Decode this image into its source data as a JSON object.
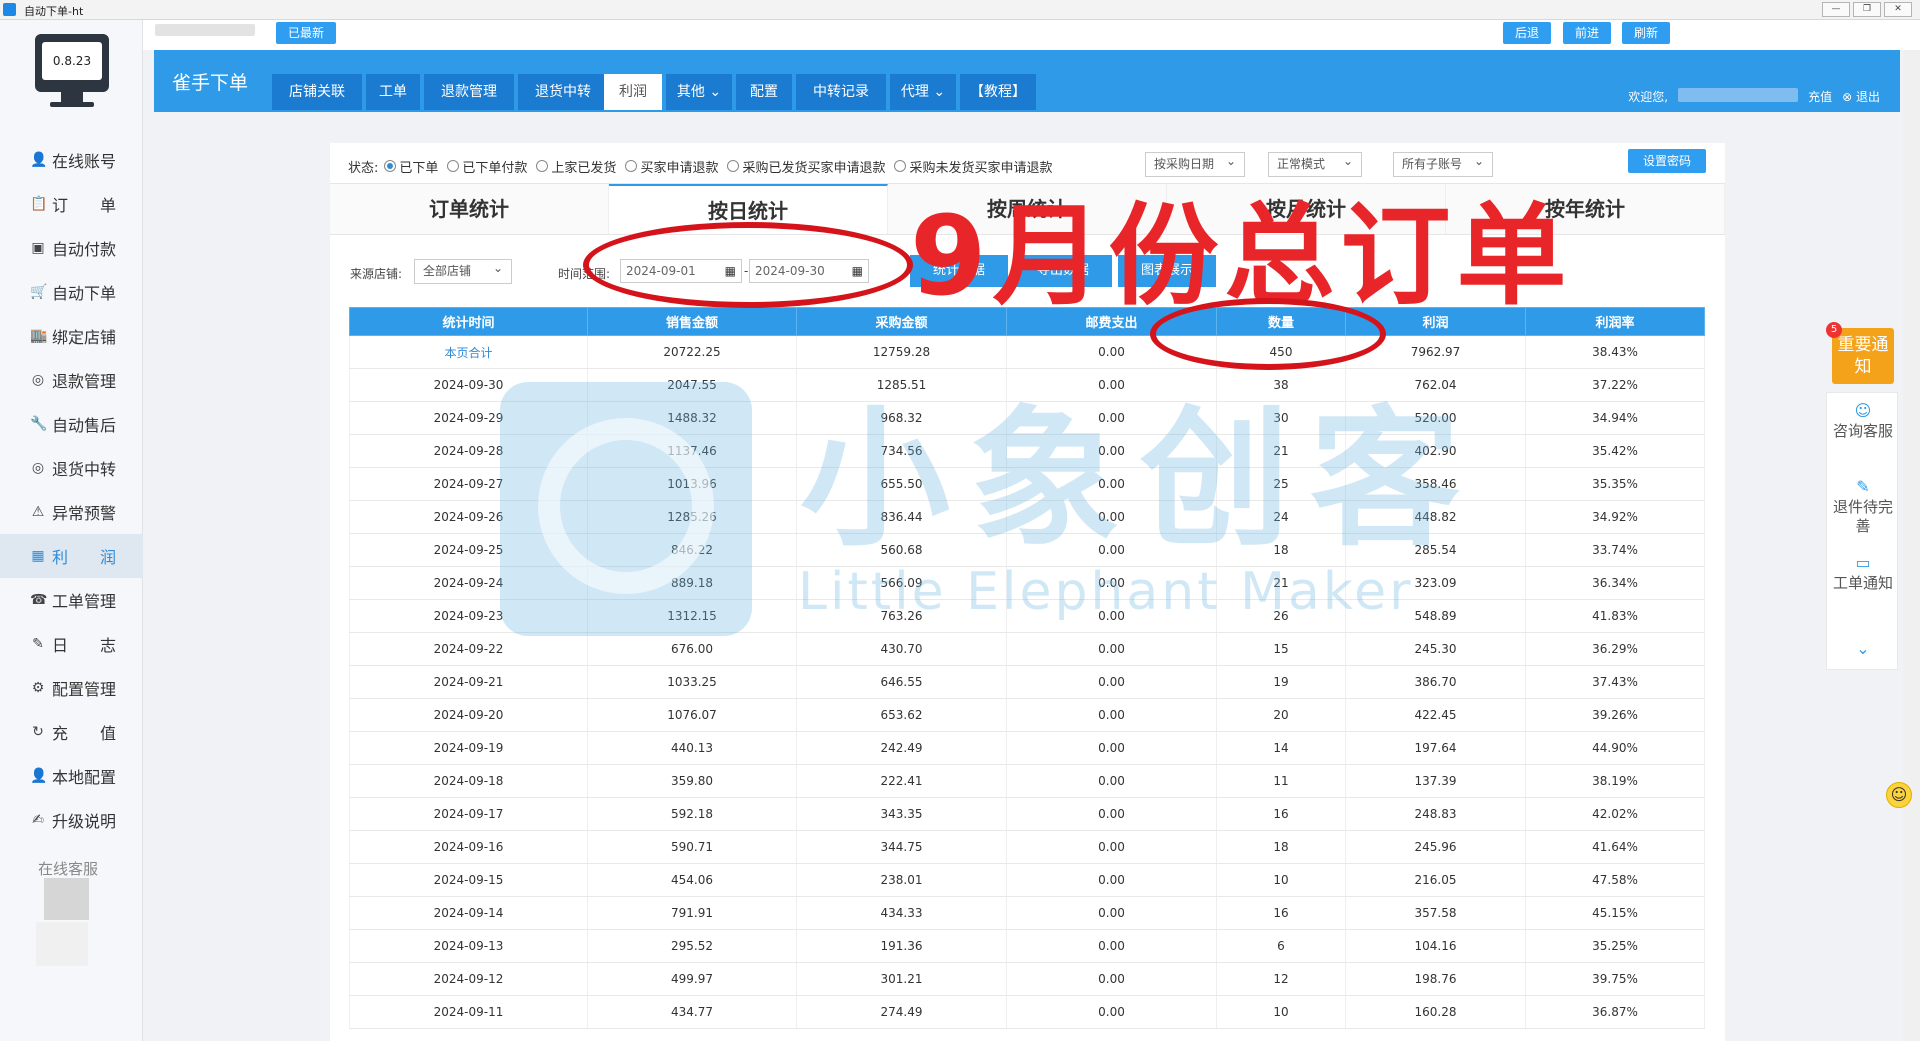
{
  "window": {
    "title": "自动下单-ht"
  },
  "app": {
    "version": "0.8.23"
  },
  "sidebar": {
    "items": [
      {
        "icon": "user-plus-icon",
        "glyph": "👤",
        "label": "在线账号"
      },
      {
        "icon": "clipboard-icon",
        "glyph": "📋",
        "label": "订　　单"
      },
      {
        "icon": "card-icon",
        "glyph": "▣",
        "label": "自动付款"
      },
      {
        "icon": "cart-icon",
        "glyph": "🛒",
        "label": "自动下单"
      },
      {
        "icon": "store-icon",
        "glyph": "🏬",
        "label": "绑定店铺"
      },
      {
        "icon": "refund-icon",
        "glyph": "◎",
        "label": "退款管理"
      },
      {
        "icon": "aftersale-icon",
        "glyph": "🔧",
        "label": "自动售后"
      },
      {
        "icon": "return-icon",
        "glyph": "◎",
        "label": "退货中转"
      },
      {
        "icon": "warning-icon",
        "glyph": "⚠",
        "label": "异常预警"
      },
      {
        "icon": "profit-icon",
        "glyph": "▦",
        "label": "利　　润"
      },
      {
        "icon": "ticket-icon",
        "glyph": "☎",
        "label": "工单管理"
      },
      {
        "icon": "pen-icon",
        "glyph": "✎",
        "label": "日　　志"
      },
      {
        "icon": "gear-icon",
        "glyph": "⚙",
        "label": "配置管理"
      },
      {
        "icon": "recharge-icon",
        "glyph": "↻",
        "label": "充　　值"
      },
      {
        "icon": "local-config-icon",
        "glyph": "👤",
        "label": "本地配置"
      },
      {
        "icon": "upgrade-icon",
        "glyph": "✍",
        "label": "升级说明"
      }
    ],
    "online_cs": "在线客服"
  },
  "topbar": {
    "refresh_latest": "已最新",
    "back": "后退",
    "forward": "前进",
    "refresh": "刷新"
  },
  "header": {
    "brand": "雀手下单",
    "tabs": [
      "店铺关联",
      "工单",
      "退款管理",
      "退货中转",
      "利润",
      "其他 ⌄",
      "配置",
      "中转记录",
      "代理 ⌄",
      "【教程】"
    ],
    "welcome": "欢迎您,",
    "recharge": "充值",
    "logout": "退出"
  },
  "filters": {
    "status_label": "状态:",
    "options": [
      "已下单",
      "已下单付款",
      "上家已发货",
      "买家申请退款",
      "采购已发货买家申请退款",
      "采购未发货买家申请退款"
    ],
    "date_type": "按采购日期",
    "mode": "正常模式",
    "sub_account": "所有子账号",
    "set_password": "设置密码"
  },
  "stat_tabs": [
    "订单统计",
    "按日统计",
    "按周统计",
    "按月统计",
    "按年统计"
  ],
  "query": {
    "shop_label": "来源店铺:",
    "shop_value": "全部店铺",
    "time_label": "时间范围:",
    "date_from": "2024-09-01",
    "date_to": "2024-09-30",
    "btn_1": "统计数据",
    "btn_2": "导出数据",
    "btn_3": "图表展示"
  },
  "table": {
    "headers": [
      "统计时间",
      "销售金额",
      "采购金额",
      "邮费支出",
      "数量",
      "利润",
      "利润率"
    ],
    "total": [
      "本页合计",
      "20722.25",
      "12759.28",
      "0.00",
      "450",
      "7962.97",
      "38.43%"
    ],
    "rows": [
      [
        "2024-09-30",
        "2047.55",
        "1285.51",
        "0.00",
        "38",
        "762.04",
        "37.22%"
      ],
      [
        "2024-09-29",
        "1488.32",
        "968.32",
        "0.00",
        "30",
        "520.00",
        "34.94%"
      ],
      [
        "2024-09-28",
        "1137.46",
        "734.56",
        "0.00",
        "21",
        "402.90",
        "35.42%"
      ],
      [
        "2024-09-27",
        "1013.96",
        "655.50",
        "0.00",
        "25",
        "358.46",
        "35.35%"
      ],
      [
        "2024-09-26",
        "1285.26",
        "836.44",
        "0.00",
        "24",
        "448.82",
        "34.92%"
      ],
      [
        "2024-09-25",
        "846.22",
        "560.68",
        "0.00",
        "18",
        "285.54",
        "33.74%"
      ],
      [
        "2024-09-24",
        "889.18",
        "566.09",
        "0.00",
        "21",
        "323.09",
        "36.34%"
      ],
      [
        "2024-09-23",
        "1312.15",
        "763.26",
        "0.00",
        "26",
        "548.89",
        "41.83%"
      ],
      [
        "2024-09-22",
        "676.00",
        "430.70",
        "0.00",
        "15",
        "245.30",
        "36.29%"
      ],
      [
        "2024-09-21",
        "1033.25",
        "646.55",
        "0.00",
        "19",
        "386.70",
        "37.43%"
      ],
      [
        "2024-09-20",
        "1076.07",
        "653.62",
        "0.00",
        "20",
        "422.45",
        "39.26%"
      ],
      [
        "2024-09-19",
        "440.13",
        "242.49",
        "0.00",
        "14",
        "197.64",
        "44.90%"
      ],
      [
        "2024-09-18",
        "359.80",
        "222.41",
        "0.00",
        "11",
        "137.39",
        "38.19%"
      ],
      [
        "2024-09-17",
        "592.18",
        "343.35",
        "0.00",
        "16",
        "248.83",
        "42.02%"
      ],
      [
        "2024-09-16",
        "590.71",
        "344.75",
        "0.00",
        "18",
        "245.96",
        "41.64%"
      ],
      [
        "2024-09-15",
        "454.06",
        "238.01",
        "0.00",
        "10",
        "216.05",
        "47.58%"
      ],
      [
        "2024-09-14",
        "791.91",
        "434.33",
        "0.00",
        "16",
        "357.58",
        "45.15%"
      ],
      [
        "2024-09-13",
        "295.52",
        "191.36",
        "0.00",
        "6",
        "104.16",
        "35.25%"
      ],
      [
        "2024-09-12",
        "499.97",
        "301.21",
        "0.00",
        "12",
        "198.76",
        "39.75%"
      ],
      [
        "2024-09-11",
        "434.77",
        "274.49",
        "0.00",
        "10",
        "160.28",
        "36.87%"
      ]
    ]
  },
  "watermark": {
    "cn": "小象创客",
    "en": "Little Elephant Maker"
  },
  "annotation": {
    "text": "9月份总订单"
  },
  "float_panel": {
    "notify_badge": "5",
    "notify": "重要通知",
    "items": [
      "咨询客服",
      "退件待完善",
      "工单通知"
    ]
  },
  "colors": {
    "primary": "#2e9ae8",
    "annotation": "#e8262a",
    "notify": "#f5a21b"
  }
}
